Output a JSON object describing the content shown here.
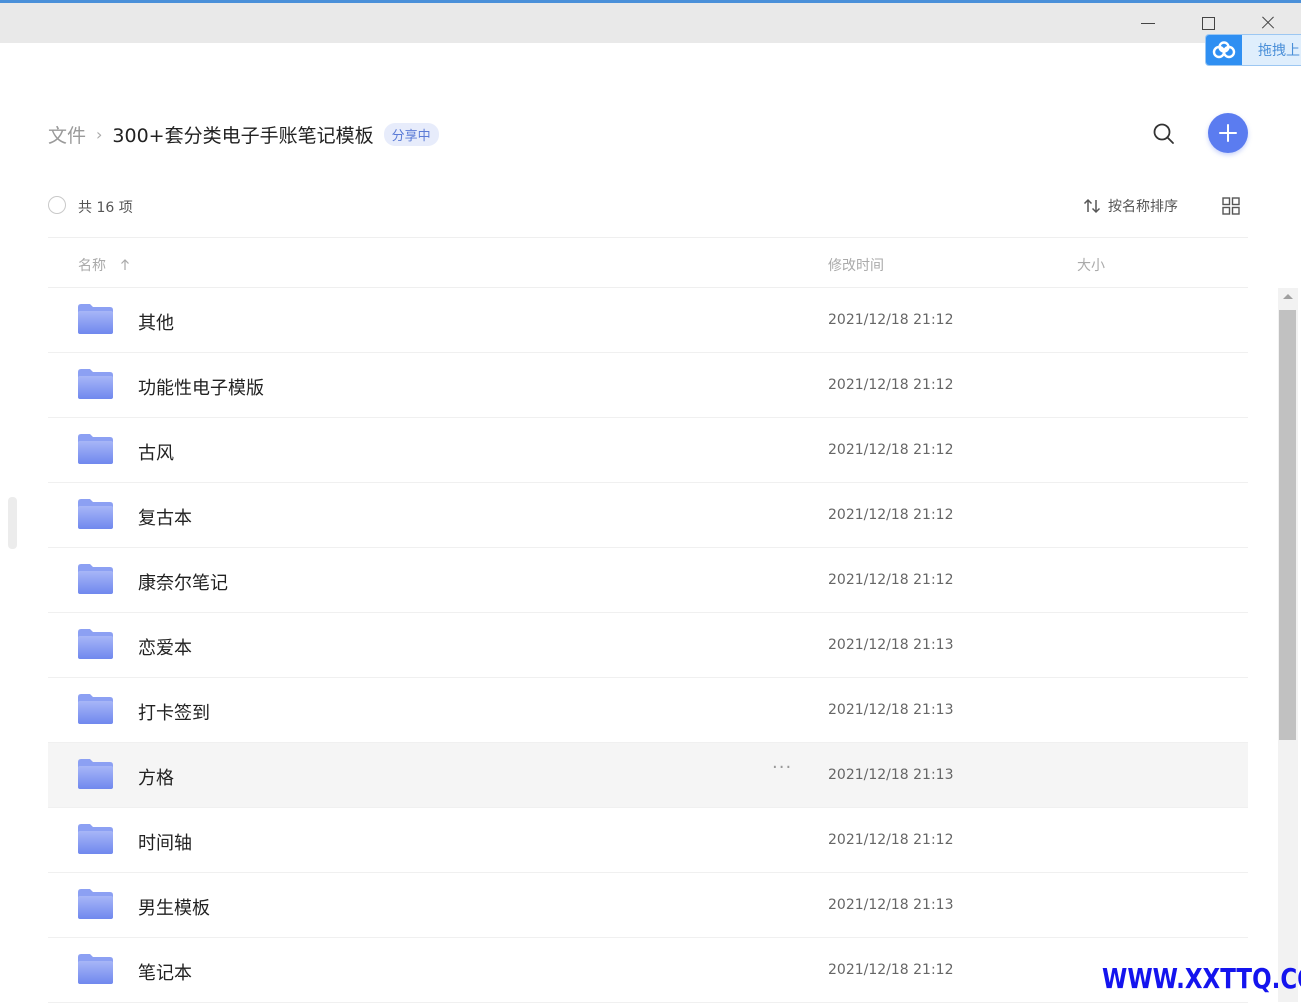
{
  "window": {
    "controls": [
      "minimize",
      "maximize",
      "close"
    ]
  },
  "drag_widget": {
    "label": "拖拽上",
    "icon": "baidu-cloud-logo-icon"
  },
  "breadcrumb": {
    "root": "文件",
    "separator": "›",
    "current": "300+套分类电子手账笔记模板",
    "badge": "分享中"
  },
  "toolbar": {
    "count_label": "共 16 项",
    "sort_label": "按名称排序",
    "search_icon": "search-icon",
    "add_icon": "plus-icon",
    "view_icon": "grid-view-icon"
  },
  "columns": {
    "name": "名称",
    "modified": "修改时间",
    "size": "大小"
  },
  "files": [
    {
      "name": "其他",
      "modified": "2021/12/18 21:12",
      "size": ""
    },
    {
      "name": "功能性电子模版",
      "modified": "2021/12/18 21:12",
      "size": ""
    },
    {
      "name": "古风",
      "modified": "2021/12/18 21:12",
      "size": ""
    },
    {
      "name": "复古本",
      "modified": "2021/12/18 21:12",
      "size": ""
    },
    {
      "name": "康奈尔笔记",
      "modified": "2021/12/18 21:12",
      "size": ""
    },
    {
      "name": "恋爱本",
      "modified": "2021/12/18 21:13",
      "size": ""
    },
    {
      "name": "打卡签到",
      "modified": "2021/12/18 21:13",
      "size": ""
    },
    {
      "name": "方格",
      "modified": "2021/12/18 21:13",
      "size": "",
      "hovered": true,
      "more": "···"
    },
    {
      "name": "时间轴",
      "modified": "2021/12/18 21:12",
      "size": ""
    },
    {
      "name": "男生模板",
      "modified": "2021/12/18 21:13",
      "size": ""
    },
    {
      "name": "笔记本",
      "modified": "2021/12/18 21:12",
      "size": ""
    }
  ],
  "watermark": "WWW.XXTTQ.COM",
  "colors": {
    "accent": "#5b7cf0",
    "folder": "#7f97f0",
    "badge_text": "#5b7bd6",
    "watermark": "#1414ee"
  }
}
